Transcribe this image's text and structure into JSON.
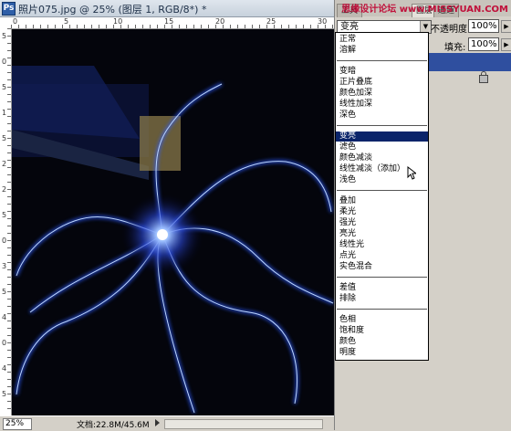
{
  "document": {
    "title": "照片075.jpg @ 25% (图层 1, RGB/8*) *",
    "app_icon": "Ps"
  },
  "rulers": {
    "top_labels": [
      "0",
      "5",
      "10",
      "15",
      "20",
      "25",
      "30"
    ],
    "left_labels": [
      "5",
      "0",
      "5",
      "1",
      "5",
      "2",
      "2",
      "5",
      "0",
      "3",
      "5",
      "4",
      "0",
      "4",
      "5"
    ]
  },
  "status": {
    "zoom": "25%",
    "doc_size": "文档:22.8M/45.6M"
  },
  "panel": {
    "tabs": [
      "工具",
      "图层",
      "通道"
    ],
    "watermark": "思缘设计论坛 www.MISSYUAN.COM",
    "blend_mode_value": "变亮",
    "opacity_label": "不透明度:",
    "opacity_value": "100%",
    "fill_label": "填充:",
    "fill_value": "100%"
  },
  "blend_menu": {
    "items": [
      "正常",
      "溶解",
      "变暗",
      "正片叠底",
      "颜色加深",
      "线性加深",
      "深色",
      "变亮",
      "滤色",
      "颜色减淡",
      "线性减淡（添加）",
      "浅色",
      "叠加",
      "柔光",
      "强光",
      "亮光",
      "线性光",
      "点光",
      "实色混合",
      "差值",
      "排除",
      "色相",
      "饱和度",
      "颜色",
      "明度"
    ],
    "selected": "变亮"
  }
}
